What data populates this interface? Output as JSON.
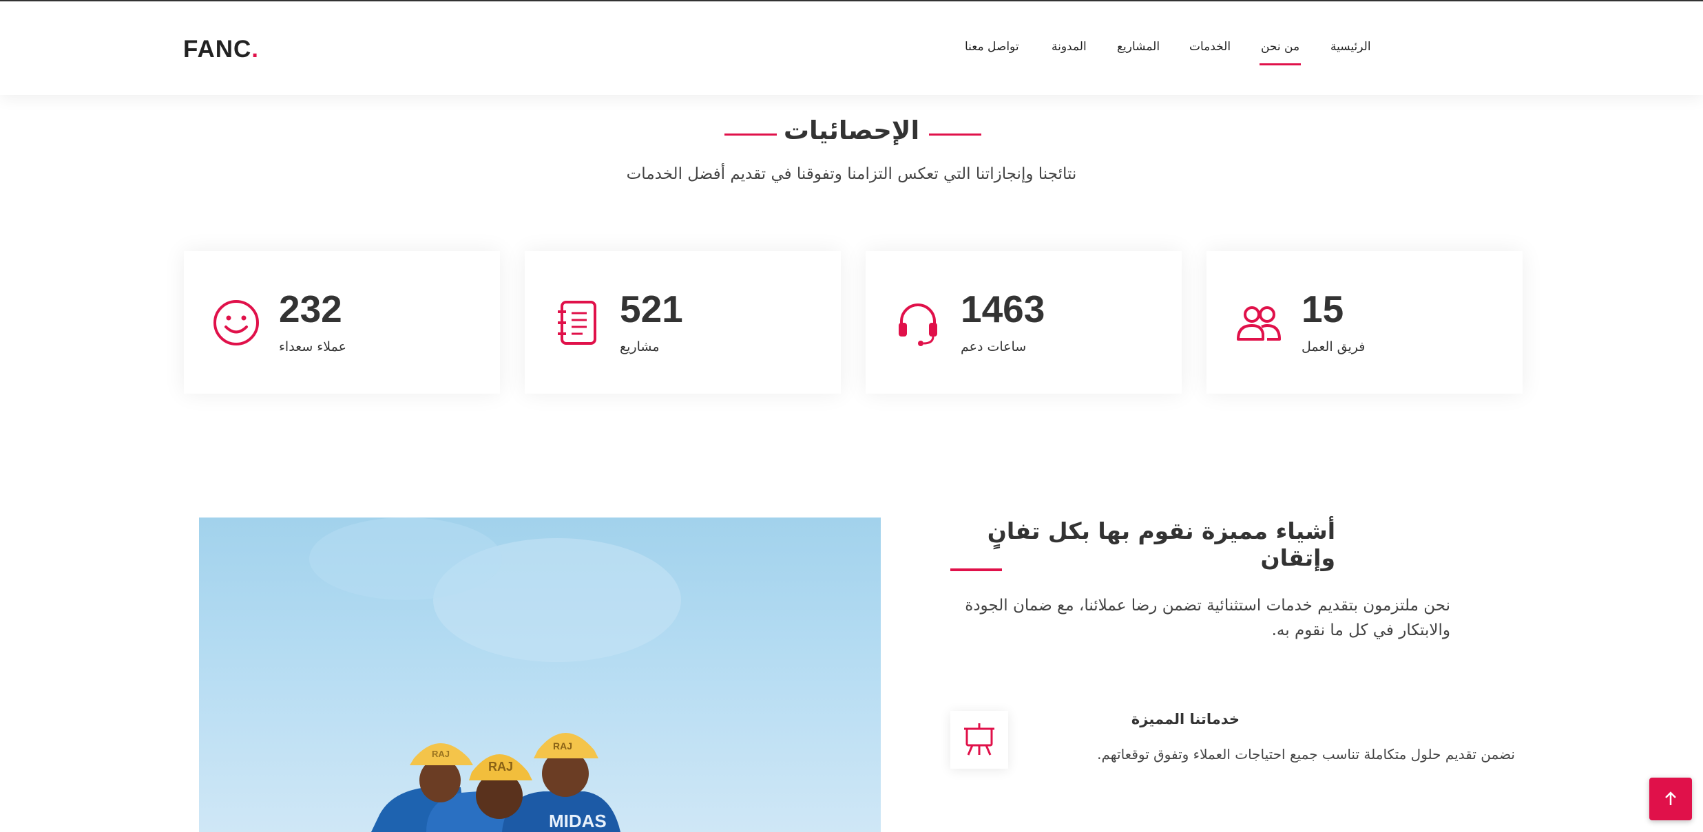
{
  "header": {
    "logo_text": "FANC",
    "logo_dot": ".",
    "nav": [
      {
        "label": "الرئيسية",
        "active": false
      },
      {
        "label": "من نحن",
        "active": true
      },
      {
        "label": "الخدمات",
        "active": false
      },
      {
        "label": "المشاريع",
        "active": false
      },
      {
        "label": "المدونة",
        "active": false
      },
      {
        "label": "تواصل معنا",
        "active": false
      }
    ]
  },
  "stats_section": {
    "title": "الإحصائيات",
    "subtitle": "نتائجنا وإنجازاتنا التي تعكس التزامنا وتفوقنا في تقديم أفضل الخدمات",
    "cards": [
      {
        "icon": "smile-icon",
        "value": "232",
        "label": "عملاء سعداء"
      },
      {
        "icon": "journal-icon",
        "value": "521",
        "label": "مشاريع"
      },
      {
        "icon": "headset-icon",
        "value": "1463",
        "label": "ساعات دعم"
      },
      {
        "icon": "people-icon",
        "value": "15",
        "label": "فريق العمل"
      }
    ]
  },
  "features_section": {
    "title": "أشياء مميزة نقوم بها بكل تفانٍ وإتقان",
    "description": "نحن ملتزمون بتقديم خدمات استثنائية تضمن رضا عملائنا، مع ضمان الجودة والابتكار في كل ما نقوم به.",
    "items": [
      {
        "icon": "easel-icon",
        "title": "خدماتنا المميزة",
        "description": "نضمن تقديم حلول متكاملة تناسب جميع احتياجات العملاء وتفوق توقعاتهم."
      }
    ],
    "photo_text": {
      "helmet_1": "RAJ",
      "helmet_2": "RAJ",
      "helmet_3": "RAJ",
      "shirt": "MIDAS"
    }
  },
  "colors": {
    "accent": "#e0114a",
    "text_dark": "#333333",
    "sky": "#a2d2ec"
  },
  "back_to_top": {
    "icon": "arrow-up-icon"
  }
}
